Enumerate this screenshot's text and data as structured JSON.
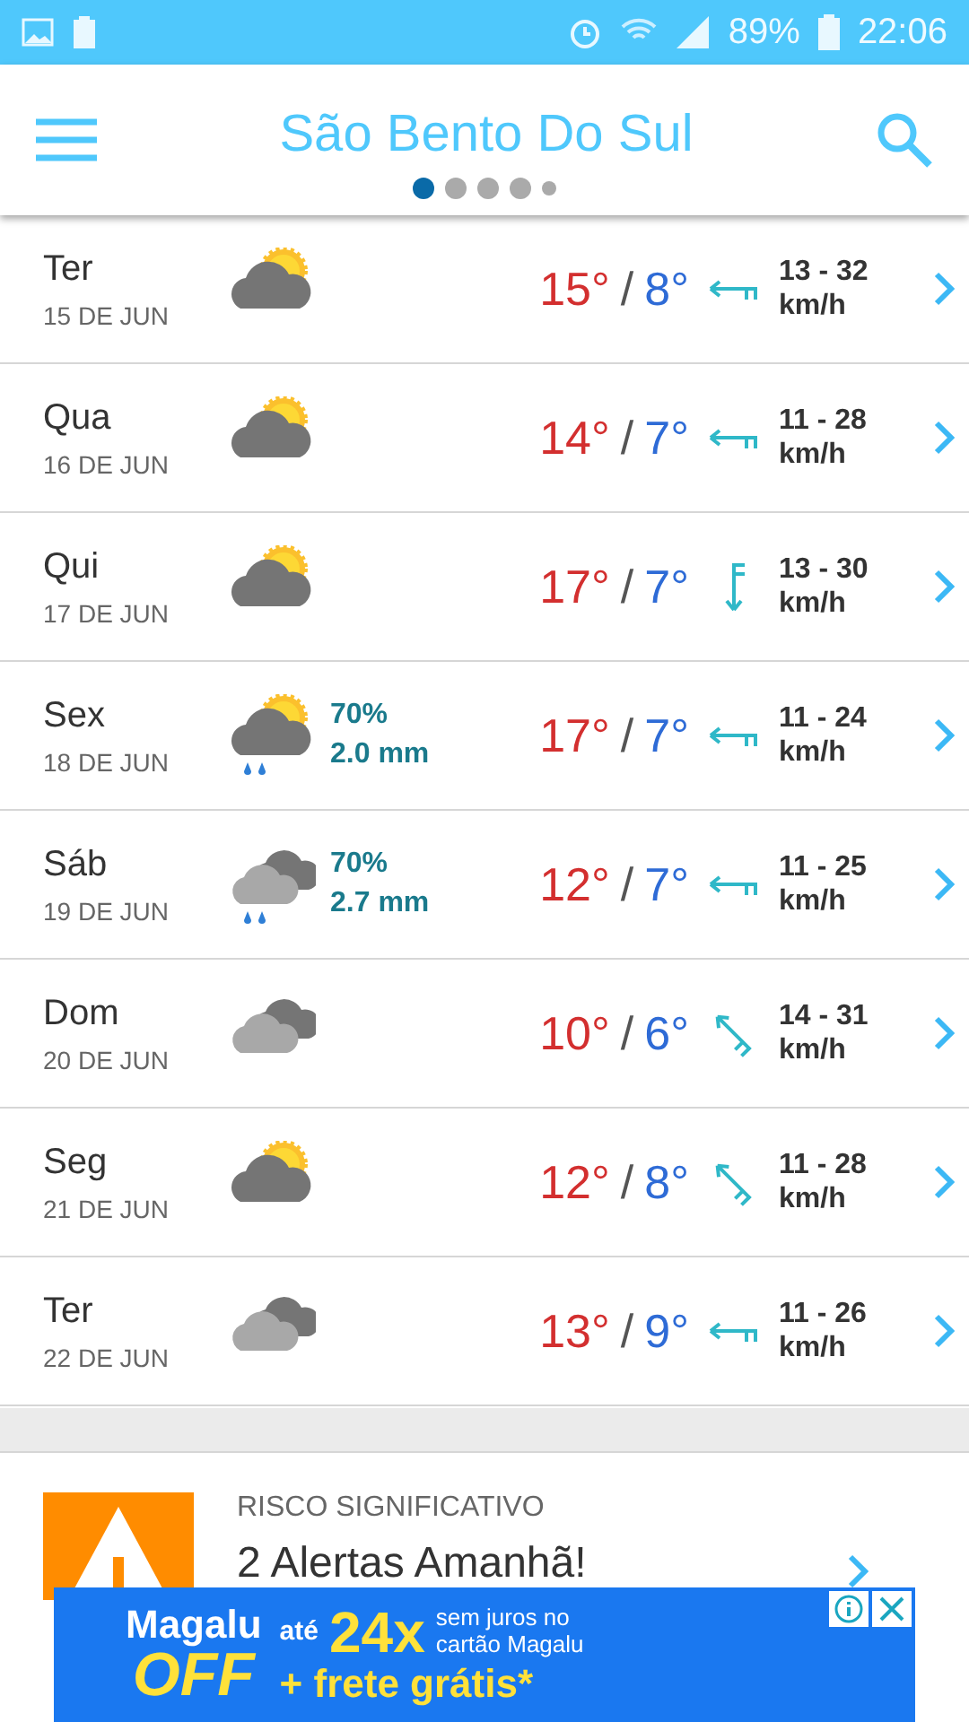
{
  "status_bar": {
    "battery": "89%",
    "time": "22:06"
  },
  "header": {
    "title": "São Bento Do Sul",
    "pages": [
      {
        "selected": true
      },
      {
        "selected": false
      },
      {
        "selected": false
      },
      {
        "selected": false
      },
      {
        "selected": false,
        "kind": "small"
      }
    ]
  },
  "days": [
    {
      "day": "Ter",
      "date": "15 DE JUN",
      "sky": {
        "kind": "partly-cloudy"
      },
      "high": "15°",
      "separator": "/",
      "low": "8°",
      "wind": {
        "kind": "west",
        "speed": "13 - 32",
        "unit": "km/h"
      }
    },
    {
      "day": "Qua",
      "date": "16 DE JUN",
      "sky": {
        "kind": "partly-cloudy"
      },
      "high": "14°",
      "separator": "/",
      "low": "7°",
      "wind": {
        "kind": "west",
        "speed": "11 - 28",
        "unit": "km/h"
      }
    },
    {
      "day": "Qui",
      "date": "17 DE JUN",
      "sky": {
        "kind": "partly-cloudy"
      },
      "high": "17°",
      "separator": "/",
      "low": "7°",
      "wind": {
        "kind": "south",
        "speed": "13 - 30",
        "unit": "km/h"
      }
    },
    {
      "day": "Sex",
      "date": "18 DE JUN",
      "sky": {
        "kind": "partly-cloudy-rain"
      },
      "chance": "70%",
      "amount": "2.0 mm",
      "high": "17°",
      "separator": "/",
      "low": "7°",
      "wind": {
        "kind": "west",
        "speed": "11 - 24",
        "unit": "km/h"
      }
    },
    {
      "day": "Sáb",
      "date": "19 DE JUN",
      "sky": {
        "kind": "cloudy-rain"
      },
      "chance": "70%",
      "amount": "2.7 mm",
      "high": "12°",
      "separator": "/",
      "low": "7°",
      "wind": {
        "kind": "west",
        "speed": "11 - 25",
        "unit": "km/h"
      }
    },
    {
      "day": "Dom",
      "date": "20 DE JUN",
      "sky": {
        "kind": "cloudy"
      },
      "high": "10°",
      "separator": "/",
      "low": "6°",
      "wind": {
        "kind": "northwest",
        "speed": "14 - 31",
        "unit": "km/h"
      }
    },
    {
      "day": "Seg",
      "date": "21 DE JUN",
      "sky": {
        "kind": "partly-cloudy"
      },
      "high": "12°",
      "separator": "/",
      "low": "8°",
      "wind": {
        "kind": "northwest",
        "speed": "11 - 28",
        "unit": "km/h"
      }
    },
    {
      "day": "Ter",
      "date": "22 DE JUN",
      "sky": {
        "kind": "cloudy"
      },
      "high": "13°",
      "separator": "/",
      "low": "9°",
      "wind": {
        "kind": "west",
        "speed": "11 - 26",
        "unit": "km/h"
      }
    }
  ],
  "alert": {
    "level": "RISCO SIGNIFICATIVO",
    "title": "2 Alertas Amanhã!"
  },
  "ad": {
    "brand": "Magalu",
    "brand_tag": "OFF",
    "prefix": "até",
    "offer": "24x",
    "terms": "sem juros no cartão Magalu",
    "extra": "+ frete grátis*"
  }
}
